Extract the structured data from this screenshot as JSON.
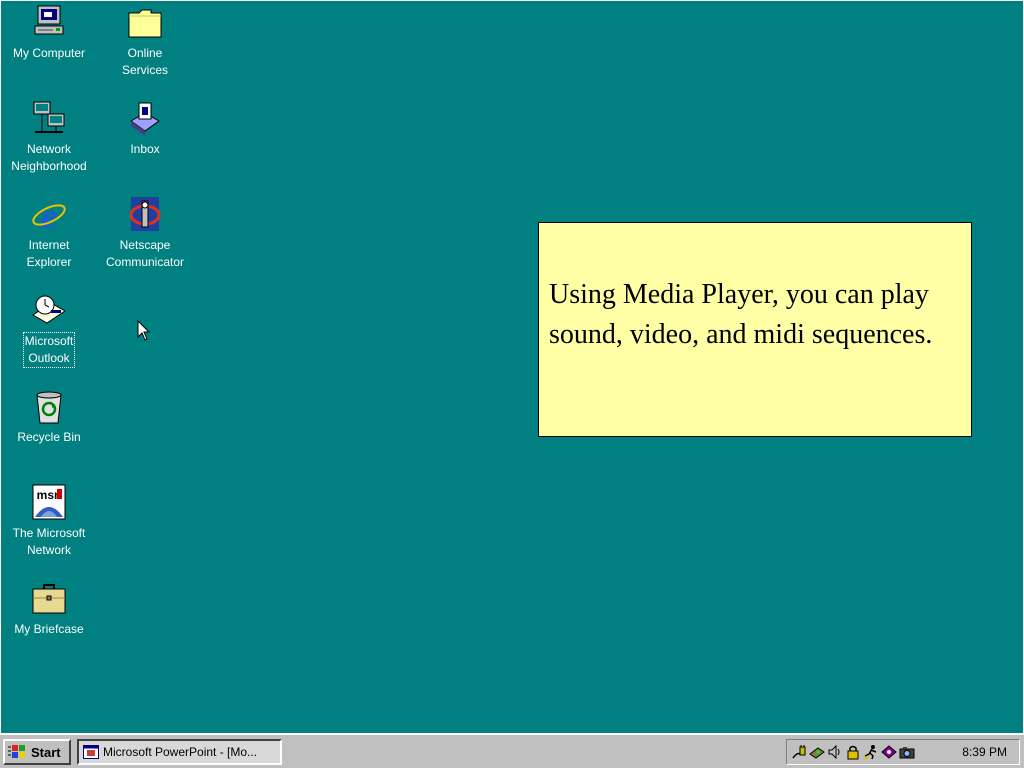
{
  "desktop": {
    "background_color": "#008080",
    "icons": [
      {
        "label_line1": "My Computer",
        "label_line2": ""
      },
      {
        "label_line1": "Online",
        "label_line2": "Services"
      },
      {
        "label_line1": "Network",
        "label_line2": "Neighborhood"
      },
      {
        "label_line1": "Inbox",
        "label_line2": ""
      },
      {
        "label_line1": "Internet",
        "label_line2": "Explorer"
      },
      {
        "label_line1": "Netscape",
        "label_line2": "Communicator"
      },
      {
        "label_line1": "Microsoft",
        "label_line2": "Outlook"
      },
      {
        "label_line1": "Recycle Bin",
        "label_line2": ""
      },
      {
        "label_line1": "The Microsoft",
        "label_line2": "Network"
      },
      {
        "label_line1": "My Briefcase",
        "label_line2": ""
      }
    ]
  },
  "note": {
    "text": "Using Media Player, you can play sound, video, and midi sequences.",
    "background_color": "#ffffa6"
  },
  "taskbar": {
    "start_label": "Start",
    "task_label": "Microsoft PowerPoint - [Mo...",
    "clock": "8:39 PM",
    "tray_icons": [
      "plug-icon",
      "modem-icon",
      "speaker-icon",
      "lock-icon",
      "runner-icon",
      "chat-icon",
      "camera-icon"
    ]
  }
}
